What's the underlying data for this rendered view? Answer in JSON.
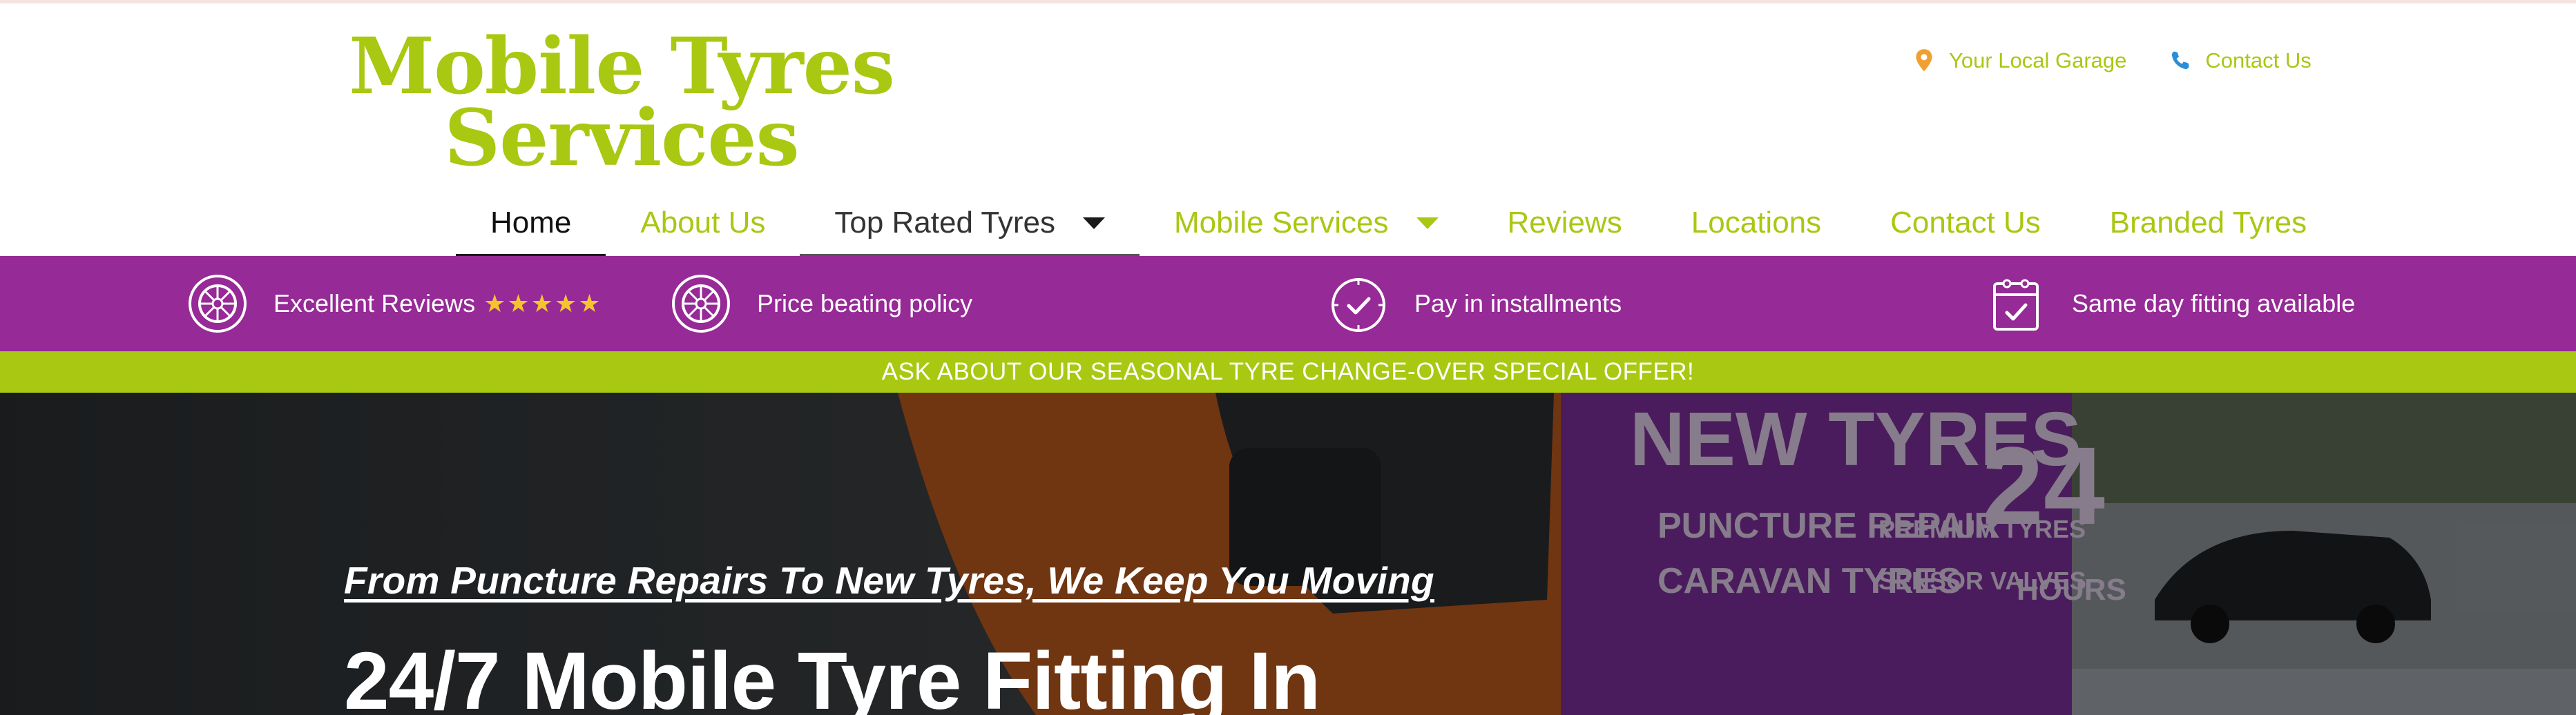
{
  "logo": {
    "line1": "Mobile Tyres",
    "line2": "Services"
  },
  "toplinks": [
    {
      "label": "Your Local Garage",
      "icon": "map-pin-icon"
    },
    {
      "label": "Contact Us",
      "icon": "phone-icon"
    }
  ],
  "nav": {
    "items": [
      {
        "label": "Home"
      },
      {
        "label": "About Us"
      },
      {
        "label": "Top Rated Tyres"
      },
      {
        "label": "Mobile Services"
      },
      {
        "label": "Reviews"
      },
      {
        "label": "Locations"
      },
      {
        "label": "Contact Us"
      },
      {
        "label": "Branded Tyres"
      }
    ]
  },
  "features": [
    {
      "label": "Excellent Reviews",
      "stars": "★★★★★",
      "icon": "tyre-icon"
    },
    {
      "label": "Price beating policy",
      "icon": "tyre-icon"
    },
    {
      "label": "Pay in installments",
      "icon": "clock-check-icon"
    },
    {
      "label": "Same day fitting available",
      "icon": "calendar-check-icon"
    }
  ],
  "promo": {
    "text": "ASK ABOUT OUR SEASONAL TYRE CHANGE-OVER SPECIAL OFFER!"
  },
  "hero": {
    "van_text_1": "NEW TYRES",
    "van_text_2": "PUNCTURE REPAIR",
    "van_text_3": "PREMIUM TYRES",
    "van_text_4": "CARAVAN TYRES",
    "van_text_5": "SENSOR VALVES",
    "van_text_6": "24",
    "van_text_7": "HOURS",
    "subtitle": "From Puncture Repairs To New Tyres, We Keep You Moving",
    "title": "24/7 Mobile Tyre Fitting In"
  },
  "colors": {
    "brand_green": "#a8c812",
    "brand_purple": "#962a96",
    "star_gold": "#f4c430"
  }
}
